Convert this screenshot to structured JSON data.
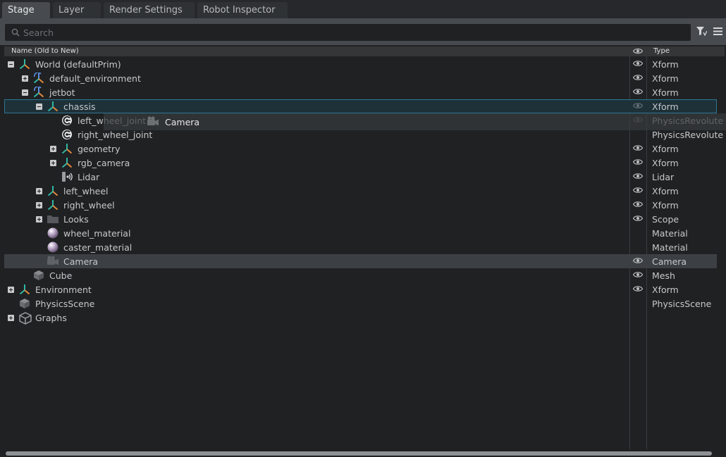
{
  "tabs": [
    {
      "label": "Stage",
      "active": true
    },
    {
      "label": "Layer",
      "active": false
    },
    {
      "label": "Render Settings",
      "active": false
    },
    {
      "label": "Robot Inspector",
      "active": false
    }
  ],
  "search": {
    "placeholder": "Search",
    "value": ""
  },
  "header": {
    "name_col": "Name (Old to New)",
    "type_col": "Type"
  },
  "rows": [
    {
      "label": "World (defaultPrim)",
      "type": "Xform",
      "icon": "xform-icon",
      "expander": "minus",
      "visible_eye": true
    },
    {
      "label": "default_environment",
      "type": "Xform",
      "icon": "xform-ref-icon",
      "expander": "plus",
      "visible_eye": true
    },
    {
      "label": "jetbot",
      "type": "Xform",
      "icon": "xform-ref-icon",
      "expander": "minus",
      "visible_eye": true
    },
    {
      "label": "chassis",
      "type": "Xform",
      "icon": "xform-icon",
      "expander": "minus",
      "visible_eye": true,
      "state": "drop-target"
    },
    {
      "label": "left_wheel_joint",
      "type": "PhysicsRevolute",
      "icon": "revolute-joint-icon",
      "expander": "none",
      "visible_eye": true
    },
    {
      "label": "right_wheel_joint",
      "type": "PhysicsRevolute",
      "icon": "revolute-joint-icon",
      "expander": "none",
      "visible_eye": false
    },
    {
      "label": "geometry",
      "type": "Xform",
      "icon": "xform-icon",
      "expander": "plus",
      "visible_eye": true
    },
    {
      "label": "rgb_camera",
      "type": "Xform",
      "icon": "xform-icon",
      "expander": "plus",
      "visible_eye": true
    },
    {
      "label": "Lidar",
      "type": "Lidar",
      "icon": "lidar-icon",
      "expander": "none",
      "visible_eye": true
    },
    {
      "label": "left_wheel",
      "type": "Xform",
      "icon": "xform-icon",
      "expander": "plus",
      "visible_eye": true
    },
    {
      "label": "right_wheel",
      "type": "Xform",
      "icon": "xform-icon",
      "expander": "plus",
      "visible_eye": true
    },
    {
      "label": "Looks",
      "type": "Scope",
      "icon": "folder-icon",
      "expander": "plus",
      "visible_eye": true
    },
    {
      "label": "wheel_material",
      "type": "Material",
      "icon": "material-sphere-icon",
      "expander": "none",
      "visible_eye": false
    },
    {
      "label": "caster_material",
      "type": "Material",
      "icon": "material-sphere-icon",
      "expander": "none",
      "visible_eye": false
    },
    {
      "label": "Camera",
      "type": "Camera",
      "icon": "camera-icon",
      "expander": "none",
      "visible_eye": true,
      "state": "selected"
    },
    {
      "label": "Cube",
      "type": "Mesh",
      "icon": "mesh-cube-icon",
      "expander": "none",
      "visible_eye": true
    },
    {
      "label": "Environment",
      "type": "Xform",
      "icon": "xform-icon",
      "expander": "plus",
      "visible_eye": true
    },
    {
      "label": "PhysicsScene",
      "type": "PhysicsScene",
      "icon": "physics-scene-icon",
      "expander": "none",
      "visible_eye": false
    },
    {
      "label": "Graphs",
      "type": "",
      "icon": "graph-cube-icon",
      "expander": "plus",
      "visible_eye": false
    }
  ],
  "drag_ghost": {
    "label": "Camera",
    "icon": "camera-icon"
  },
  "colors": {
    "accent": "#2f7593",
    "selected_row": "#3c4044",
    "panel": "#1f2123",
    "xform_teal": "#2fb7a3",
    "xform_orange": "#e2883a",
    "xform_blue": "#5e8fe0"
  }
}
